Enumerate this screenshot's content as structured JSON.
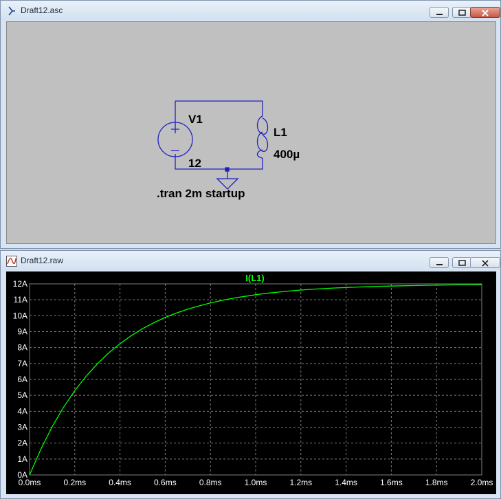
{
  "schematic_window": {
    "title": "Draft12.asc",
    "components": {
      "source_name": "V1",
      "source_value": "12",
      "inductor_name": "L1",
      "inductor_value": "400µ",
      "directive": ".tran 2m startup"
    }
  },
  "plot_window": {
    "title": "Draft12.raw",
    "trace_color": "#00ff00",
    "background": "#000000",
    "grid_color": "#808080"
  },
  "chart_data": {
    "type": "line",
    "title": "",
    "xlabel": "",
    "ylabel": "",
    "xlim": [
      0,
      2.0
    ],
    "ylim": [
      0,
      12
    ],
    "x_unit": "ms",
    "x_ticks": [
      "0.0ms",
      "0.2ms",
      "0.4ms",
      "0.6ms",
      "0.8ms",
      "1.0ms",
      "1.2ms",
      "1.4ms",
      "1.6ms",
      "1.8ms",
      "2.0ms"
    ],
    "y_ticks": [
      "0A",
      "1A",
      "2A",
      "3A",
      "4A",
      "5A",
      "6A",
      "7A",
      "8A",
      "9A",
      "10A",
      "11A",
      "12A"
    ],
    "grid": true,
    "legend": "top-center",
    "series": [
      {
        "name": "I(L1)",
        "x": [
          0,
          0.05,
          0.1,
          0.15,
          0.2,
          0.25,
          0.3,
          0.35,
          0.4,
          0.45,
          0.5,
          0.55,
          0.6,
          0.65,
          0.7,
          0.75,
          0.8,
          0.85,
          0.9,
          0.95,
          1.0,
          1.05,
          1.1,
          1.15,
          1.2,
          1.25,
          1.3,
          1.35,
          1.4,
          1.45,
          1.5,
          1.55,
          1.6,
          1.65,
          1.7,
          1.75,
          1.8,
          1.85,
          1.9,
          1.95,
          2.0
        ],
        "y": [
          0,
          1.62,
          3.03,
          4.24,
          5.29,
          6.2,
          6.98,
          7.66,
          8.24,
          8.75,
          9.19,
          9.56,
          9.89,
          10.17,
          10.41,
          10.62,
          10.8,
          10.96,
          11.1,
          11.21,
          11.32,
          11.41,
          11.48,
          11.55,
          11.61,
          11.66,
          11.7,
          11.74,
          11.77,
          11.8,
          11.82,
          11.85,
          11.86,
          11.88,
          11.89,
          11.91,
          11.92,
          11.93,
          11.94,
          11.94,
          11.95
        ]
      }
    ]
  }
}
